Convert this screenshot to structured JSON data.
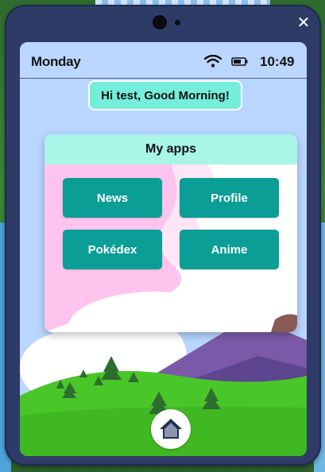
{
  "status_bar": {
    "day": "Monday",
    "time": "10:49",
    "wifi_icon": "wifi-icon",
    "battery_icon": "battery-icon"
  },
  "greeting": "Hi test, Good Morning!",
  "apps_card": {
    "title": "My apps",
    "apps": [
      {
        "label": "News"
      },
      {
        "label": "Profile"
      },
      {
        "label": "Pokédex"
      },
      {
        "label": "Anime"
      }
    ]
  },
  "home_icon": "home-icon",
  "close_icon": "close-icon",
  "colors": {
    "device_frame": "#2e3b66",
    "greeting_bg": "#74eedb",
    "apps_header_bg": "#a9f5e8",
    "app_button_bg": "#0a9e96",
    "sky": "#b9d6ff",
    "grass": "#49c628"
  }
}
